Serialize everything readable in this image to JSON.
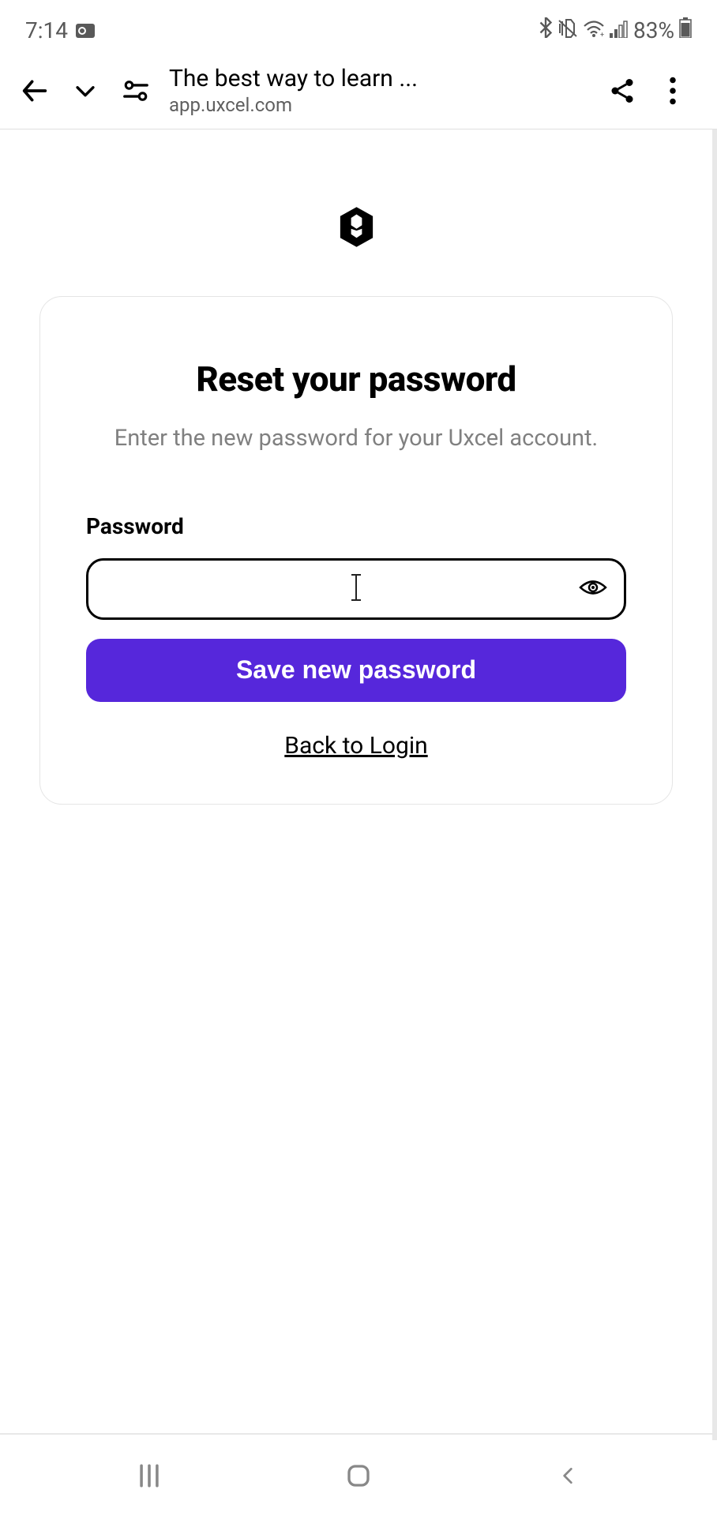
{
  "status": {
    "time": "7:14",
    "battery": "83%"
  },
  "browser": {
    "title": "The best way to learn ...",
    "url": "app.uxcel.com"
  },
  "card": {
    "heading": "Reset your password",
    "subtext": "Enter the new password for your Uxcel account.",
    "password_label": "Password",
    "password_value": "",
    "save_button": "Save new password",
    "back_link": "Back to Login"
  }
}
